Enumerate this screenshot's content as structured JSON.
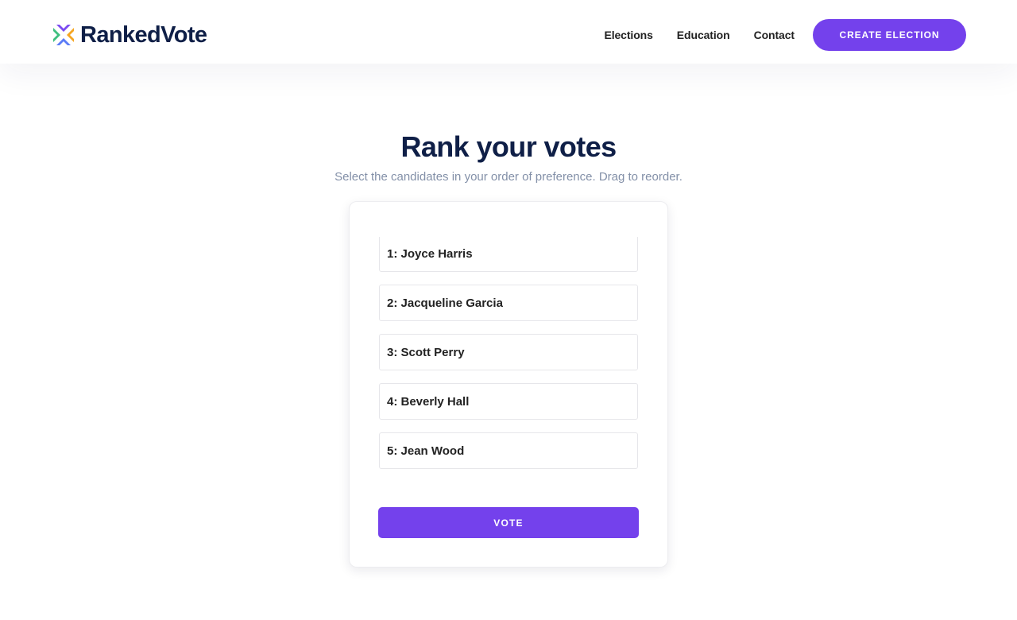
{
  "brand": {
    "name": "RankedVote",
    "logo_icon": "ranked-vote-x-icon",
    "logo_colors": [
      "#7b4bf0",
      "#f5a623",
      "#5b7cf7",
      "#3fbf7f"
    ]
  },
  "nav": {
    "links": [
      {
        "label": "Elections"
      },
      {
        "label": "Education"
      },
      {
        "label": "Contact"
      }
    ],
    "cta_label": "CREATE ELECTION"
  },
  "page": {
    "title": "Rank your votes",
    "subtitle": "Select the candidates in your order of preference. Drag to reorder."
  },
  "ballot": {
    "candidates": [
      {
        "label": "1: Joyce Harris"
      },
      {
        "label": "2: Jacqueline Garcia"
      },
      {
        "label": "3: Scott Perry"
      },
      {
        "label": "4: Beverly Hall"
      },
      {
        "label": "5: Jean Wood"
      }
    ],
    "vote_label": "VOTE"
  },
  "colors": {
    "accent": "#7441ec",
    "heading": "#0f1f47",
    "muted": "#8390a8"
  }
}
